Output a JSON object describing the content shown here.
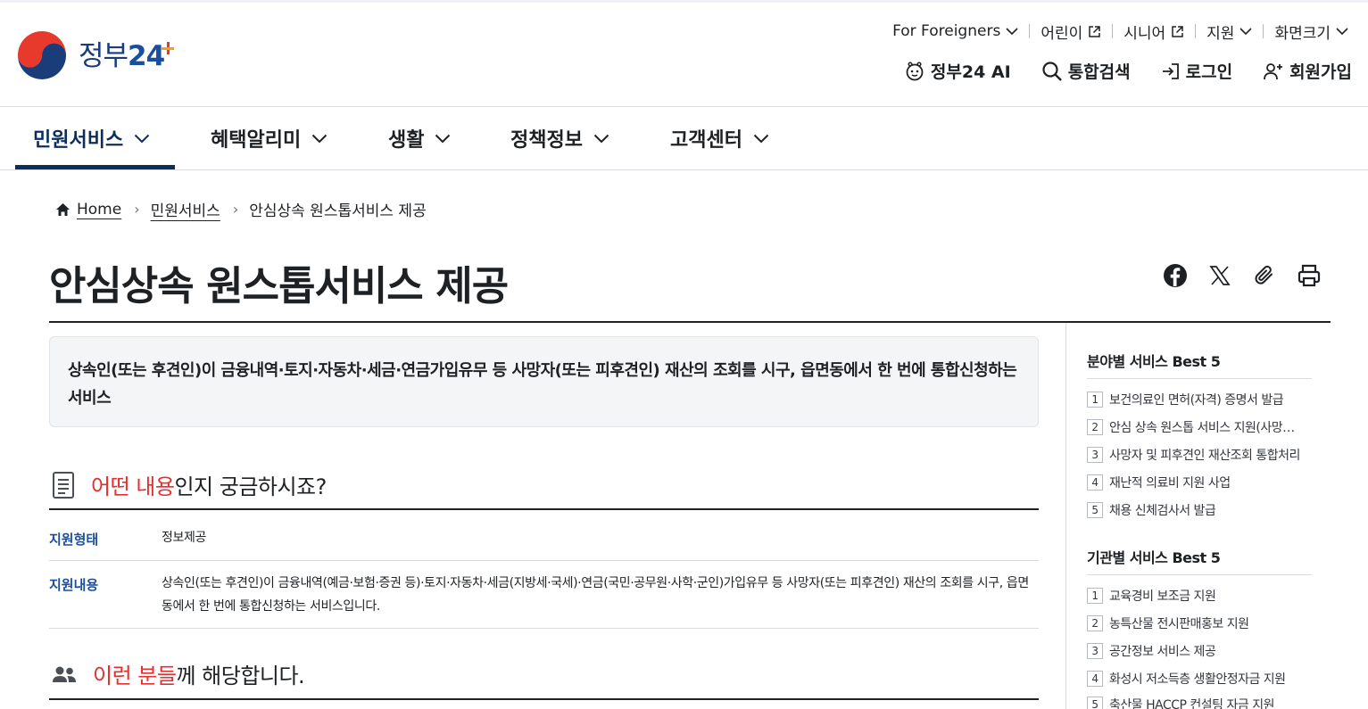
{
  "header": {
    "logo_text": "정부",
    "logo_number": "24",
    "utility": [
      {
        "label": "For Foreigners"
      },
      {
        "label": "어린이"
      },
      {
        "label": "시니어"
      },
      {
        "label": "지원"
      },
      {
        "label": "화면크기"
      }
    ],
    "tools": {
      "ai_label": "정부24 AI",
      "search_label": "통합검색",
      "login_label": "로그인",
      "signup_label": "회원가입"
    }
  },
  "nav": {
    "items": [
      {
        "label": "민원서비스"
      },
      {
        "label": "혜택알리미"
      },
      {
        "label": "생활"
      },
      {
        "label": "정책정보"
      },
      {
        "label": "고객센터"
      }
    ]
  },
  "breadcrumb": {
    "home": "Home",
    "level1": "민원서비스",
    "current": "안심상속 원스톱서비스 제공",
    "separator": "›"
  },
  "page": {
    "title": "안심상속 원스톱서비스 제공",
    "summary_line1": "상속인(또는 후견인)이 금융내역·토지·자동차·세금·연금가입유무 등 사망자(또는 피후견인) 재산의 조회를 시구, 읍면동에서 한 번에 통합신청하는",
    "summary_line2": "서비스"
  },
  "section_info": {
    "title_highlight": "어떤 내용",
    "title_rest": "인지 궁금하시죠?",
    "rows": [
      {
        "label": "지원형태",
        "value": "정보제공"
      },
      {
        "label": "지원내용",
        "value": "상속인(또는 후견인)이 금융내역(예금·보험·증권 등)·토지·자동차·세금(지방세·국세)·연금(국민·공무원·사학·군인)가입유무 등 사망자(또는 피후견인) 재산의 조회를 시구, 읍면동에서 한 번에 통합신청하는 서비스입니다."
      }
    ]
  },
  "section_target": {
    "title_highlight": "이런 분들",
    "title_rest": "께 해당합니다."
  },
  "sidebar": {
    "field_title": "분야별 서비스 Best 5",
    "field_items": [
      {
        "num": "1",
        "label": "보건의료인 면허(자격) 증명서 발급"
      },
      {
        "num": "2",
        "label": "안심 상속 원스톱 서비스 지원(사망자 재산조회)"
      },
      {
        "num": "3",
        "label": "사망자 및 피후견인 재산조회 통합처리"
      },
      {
        "num": "4",
        "label": "재난적 의료비 지원 사업"
      },
      {
        "num": "5",
        "label": "채용 신체검사서 발급"
      }
    ],
    "org_title": "기관별 서비스 Best 5",
    "org_items": [
      {
        "num": "1",
        "label": "교육경비 보조금 지원"
      },
      {
        "num": "2",
        "label": "농특산물 전시판매홍보 지원"
      },
      {
        "num": "3",
        "label": "공간정보 서비스 제공"
      },
      {
        "num": "4",
        "label": "화성시 저소득층 생활안정자금 지원"
      },
      {
        "num": "5",
        "label": "축산물 HACCP 컨설팅 자금 지원"
      }
    ]
  },
  "colors": {
    "brand_navy": "#0b2e5c",
    "accent_red": "#e52f2f",
    "label_blue": "#1a4fa0"
  }
}
